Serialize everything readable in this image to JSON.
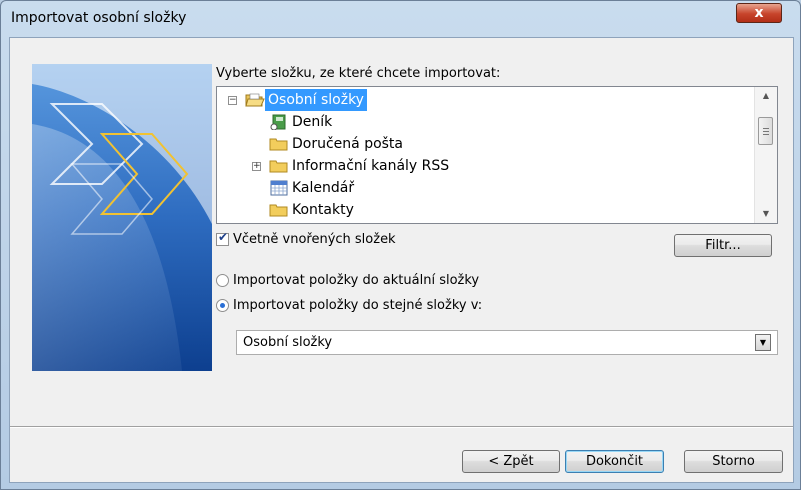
{
  "window": {
    "title": "Importovat osobní složky",
    "close_label": "x"
  },
  "prompt": "Vyberte složku, ze které chcete importovat:",
  "tree": {
    "items": [
      {
        "label": "Osobní složky",
        "expander": "−",
        "icon": "open-folder-icon",
        "selected": true
      },
      {
        "label": "Deník",
        "icon": "journal-icon"
      },
      {
        "label": "Doručená pošta",
        "icon": "folder-icon"
      },
      {
        "label": "Informační kanály RSS",
        "expander": "+",
        "icon": "folder-icon"
      },
      {
        "label": "Kalendář",
        "icon": "calendar-icon"
      },
      {
        "label": "Kontakty",
        "icon": "folder-icon"
      }
    ]
  },
  "include_subfolders": {
    "label": "Včetně vnořených složek",
    "checked": true
  },
  "filter_button": "Filtr...",
  "radios": [
    {
      "label": "Importovat položky do aktuální složky",
      "selected": false
    },
    {
      "label": "Importovat položky do stejné složky v:",
      "selected": true
    }
  ],
  "target_folder": {
    "value": "Osobní složky"
  },
  "buttons": {
    "back": "< Zpět",
    "finish": "Dokončit",
    "cancel": "Storno"
  },
  "colors": {
    "selection": "#3399ff",
    "banner_accent": "#f1c232"
  }
}
